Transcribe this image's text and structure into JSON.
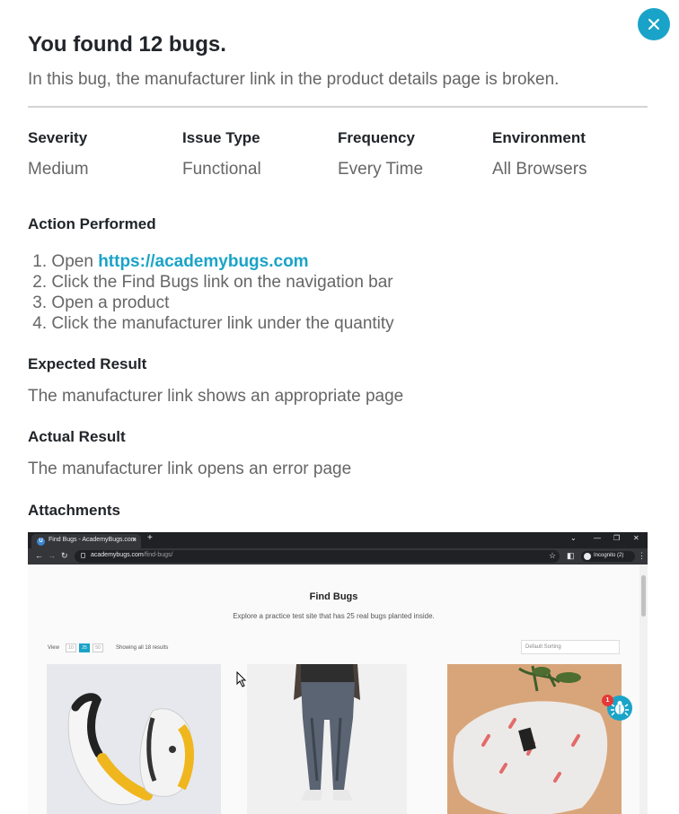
{
  "modal": {
    "title": "You found 12 bugs.",
    "description": "In this bug, the manufacturer link in the product details page is broken."
  },
  "meta": [
    {
      "label": "Severity",
      "value": "Medium"
    },
    {
      "label": "Issue Type",
      "value": "Functional"
    },
    {
      "label": "Frequency",
      "value": "Every Time"
    },
    {
      "label": "Environment",
      "value": "All Browsers"
    }
  ],
  "action": {
    "heading": "Action Performed",
    "steps": [
      {
        "num": "1.",
        "text": "Open ",
        "link": "https://academybugs.com"
      },
      {
        "num": "2.",
        "text": "Click the Find Bugs link on the navigation bar"
      },
      {
        "num": "3.",
        "text": "Open a product"
      },
      {
        "num": "4.",
        "text": "Click the manufacturer link under the quantity"
      }
    ]
  },
  "expected": {
    "heading": "Expected Result",
    "text": "The manufacturer link shows an appropriate page"
  },
  "actual": {
    "heading": "Actual Result",
    "text": "The manufacturer link opens an error page"
  },
  "attachments": {
    "heading": "Attachments"
  },
  "screenshot": {
    "tab_title": "Find Bugs - AcademyBugs.com",
    "tab_close": "×",
    "new_tab": "+",
    "url_host": "academybugs.com",
    "url_path": "/find-bugs/",
    "incognito": "Incognito (2)",
    "page_title": "Find Bugs",
    "page_subtitle": "Explore a practice test site that has 25 real bugs planted inside.",
    "view_label": "View",
    "view_options": [
      "10",
      "25",
      "50"
    ],
    "view_active": "25",
    "showing": "Showing all 18 results",
    "sort": "Default Sorting",
    "bug_count": "1",
    "colors": {
      "accent": "#1aa3c8",
      "badge": "#e53935"
    }
  }
}
